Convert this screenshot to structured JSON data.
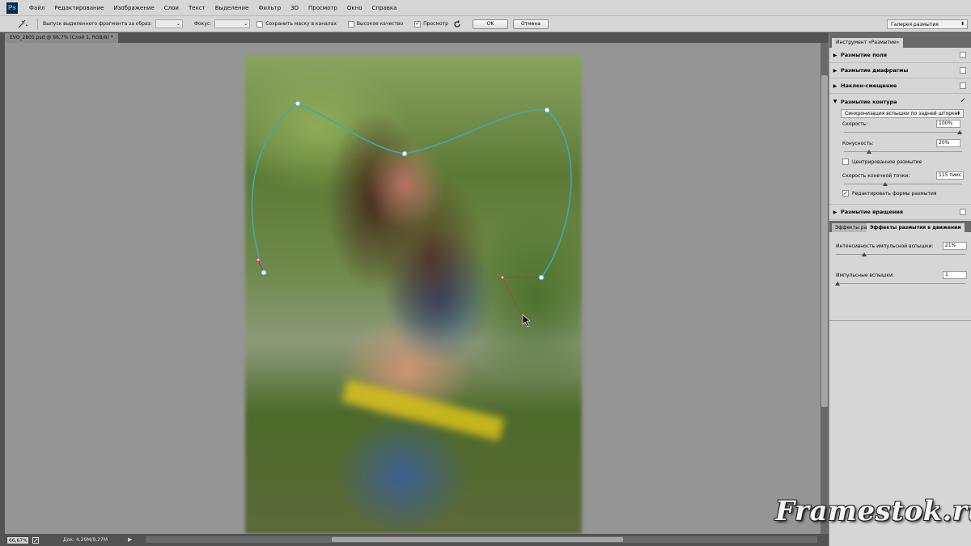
{
  "menu": [
    "Файл",
    "Редактирование",
    "Изображение",
    "Слои",
    "Текст",
    "Выделение",
    "Фильтр",
    "3D",
    "Просмотр",
    "Окно",
    "Справка"
  ],
  "options_bar": {
    "selection_label": "Выпуск выделенного фрагмента за образ:",
    "focus_label": "Фокус:",
    "save_mask_label": "Сохранить маску в каналах",
    "high_quality_label": "Высокое качество",
    "preview_label": "Просмотр",
    "preview_checked": "✓",
    "ok_label": "OK",
    "cancel_label": "Отмена",
    "workspace_select": "Галерея размытия"
  },
  "document": {
    "tab_title": "EVG_2805.psd @ 66,7% (Слой 1, RGB/8) *"
  },
  "status_bar": {
    "zoom": "66,67%",
    "doc_size": "Док: 4,29M/9,27M"
  },
  "panel": {
    "title": "Инструмент «Размытие»",
    "sections": [
      {
        "label": "Размытие поля",
        "checked": ""
      },
      {
        "label": "Размытие диафрагмы",
        "checked": ""
      },
      {
        "label": "Наклон-смещение",
        "checked": ""
      },
      {
        "label": "Размытие контура",
        "checked": "✓"
      }
    ],
    "path_blur": {
      "mode": "Синхронизация вспышки по задней шторке",
      "speed_label": "Скорость:",
      "speed_value": "100%",
      "speed_level": 1.0,
      "taper_label": "Конусность:",
      "taper_value": "20%",
      "taper_level": 0.2,
      "centered_label": "Центрированное размытие",
      "endpoint_label": "Скорость конечной точки:",
      "endpoint_value": "115 пикс.",
      "edit_shapes_label": "Редактировать формы размытия",
      "edit_shapes_checked": "✓"
    },
    "spin_blur": {
      "label": "Размытие вращения",
      "checked": ""
    },
    "effects_tabs": [
      "Эффекты ра",
      "Эффекты размытия в движении"
    ],
    "motion_effects": {
      "strobe_strength_label": "Интенсивность импульсной вспышки:",
      "strobe_strength_value": "21%",
      "strobe_strength_level": 0.21,
      "strobe_flashes_label": "Импульсные вспышки:",
      "strobe_flashes_value": "1"
    }
  },
  "watermark": "Framestok.ru",
  "colors": {
    "path": "#3fa9b0",
    "end_marker": "#cc2244",
    "ui_bg": "#d6d6d6",
    "canvas_bg": "#959595"
  }
}
